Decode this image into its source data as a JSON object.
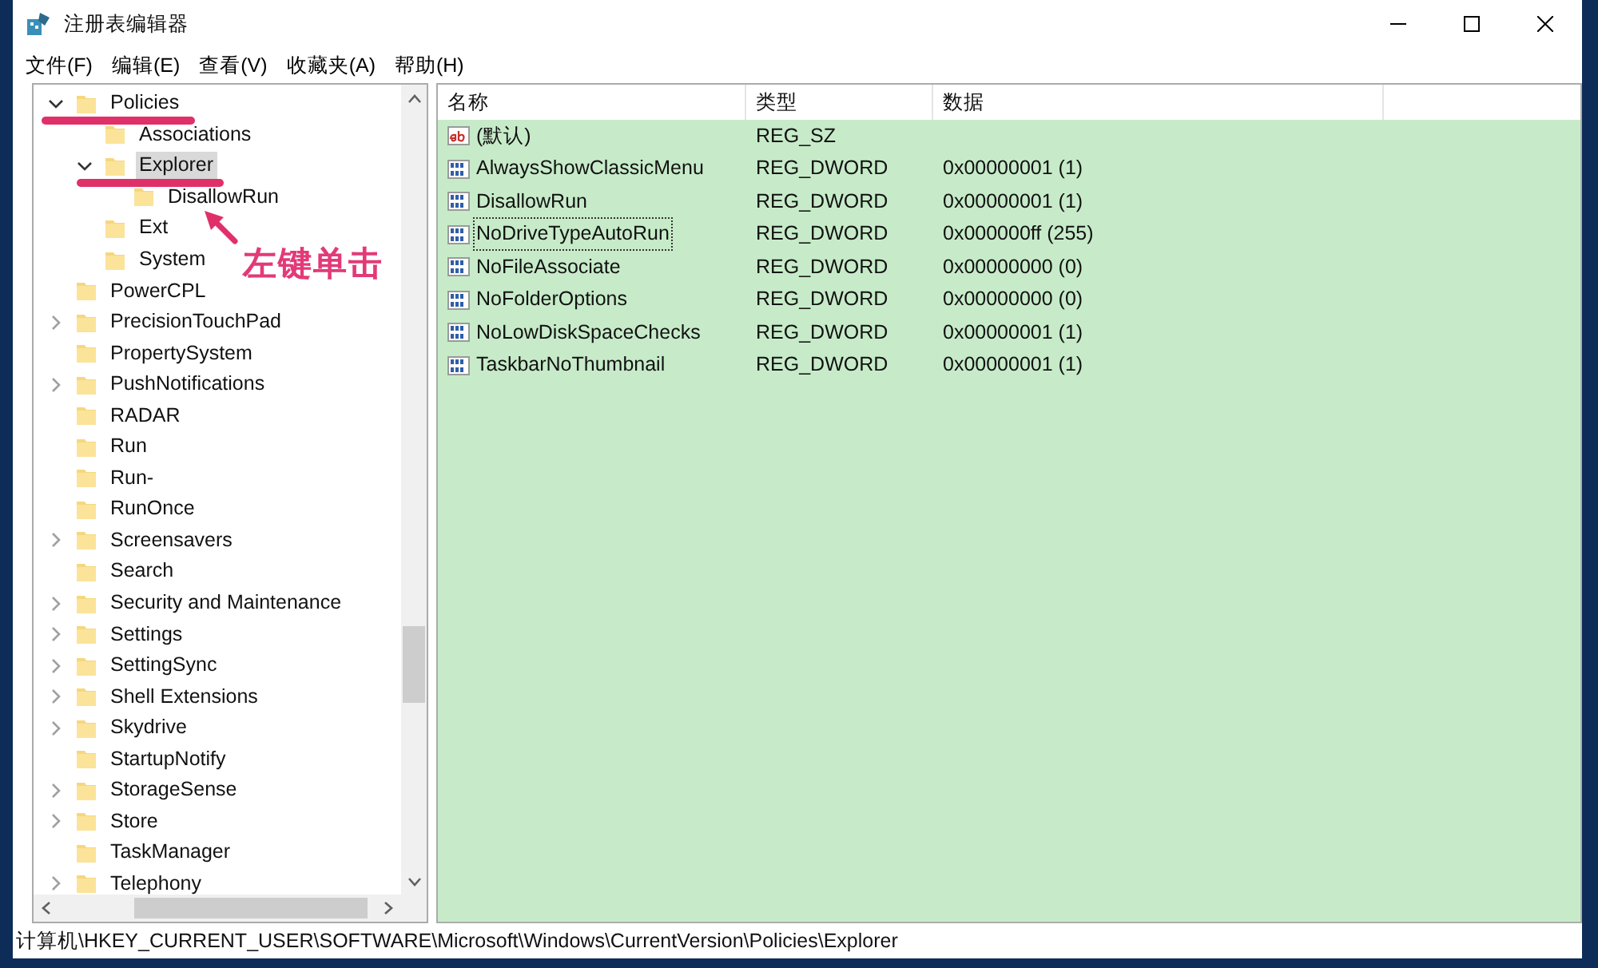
{
  "window": {
    "title": "注册表编辑器"
  },
  "menu": [
    "文件(F)",
    "编辑(E)",
    "查看(V)",
    "收藏夹(A)",
    "帮助(H)"
  ],
  "tree": [
    {
      "label": "Policies",
      "expanded": true,
      "selected": false,
      "children": [
        {
          "label": "Associations",
          "selected": false
        },
        {
          "label": "Explorer",
          "expanded": true,
          "selected": true,
          "children": [
            {
              "label": "DisallowRun",
              "selected": false
            }
          ]
        },
        {
          "label": "Ext",
          "selected": false
        },
        {
          "label": "System",
          "selected": false
        }
      ]
    },
    {
      "label": "PowerCPL",
      "selected": false
    },
    {
      "label": "PrecisionTouchPad",
      "expanded": false,
      "selected": false
    },
    {
      "label": "PropertySystem",
      "selected": false
    },
    {
      "label": "PushNotifications",
      "expanded": false,
      "selected": false
    },
    {
      "label": "RADAR",
      "selected": false
    },
    {
      "label": "Run",
      "selected": false
    },
    {
      "label": "Run-",
      "selected": false
    },
    {
      "label": "RunOnce",
      "selected": false
    },
    {
      "label": "Screensavers",
      "expanded": false,
      "selected": false
    },
    {
      "label": "Search",
      "selected": false
    },
    {
      "label": "Security and Maintenance",
      "expanded": false,
      "selected": false
    },
    {
      "label": "Settings",
      "expanded": false,
      "selected": false
    },
    {
      "label": "SettingSync",
      "expanded": false,
      "selected": false
    },
    {
      "label": "Shell Extensions",
      "expanded": false,
      "selected": false
    },
    {
      "label": "Skydrive",
      "expanded": false,
      "selected": false
    },
    {
      "label": "StartupNotify",
      "selected": false
    },
    {
      "label": "StorageSense",
      "expanded": false,
      "selected": false
    },
    {
      "label": "Store",
      "expanded": false,
      "selected": false
    },
    {
      "label": "TaskManager",
      "selected": false
    },
    {
      "label": "Telephony",
      "expanded": false,
      "selected": false
    }
  ],
  "values": {
    "columns": [
      "名称",
      "类型",
      "数据"
    ],
    "rows": [
      {
        "kind": "string",
        "name": "(默认)",
        "type": "REG_SZ",
        "focused": false
      },
      {
        "kind": "number",
        "name": "AlwaysShowClassicMenu",
        "type": "REG_DWORD",
        "data": "0x00000001 (1)",
        "focused": false
      },
      {
        "kind": "number",
        "name": "DisallowRun",
        "type": "REG_DWORD",
        "data": "0x00000001 (1)",
        "focused": false
      },
      {
        "kind": "number",
        "name": "NoDriveTypeAutoRun",
        "type": "REG_DWORD",
        "data": "0x000000ff (255)",
        "focused": true
      },
      {
        "kind": "number",
        "name": "NoFileAssociate",
        "type": "REG_DWORD",
        "data": "0x00000000 (0)",
        "focused": false
      },
      {
        "kind": "number",
        "name": "NoFolderOptions",
        "type": "REG_DWORD",
        "data": "0x00000000 (0)",
        "focused": false
      },
      {
        "kind": "number",
        "name": "NoLowDiskSpaceChecks",
        "type": "REG_DWORD",
        "data": "0x00000001 (1)",
        "focused": false
      },
      {
        "kind": "number",
        "name": "TaskbarNoThumbnail",
        "type": "REG_DWORD",
        "data": "0x00000001 (1)",
        "focused": false
      }
    ]
  },
  "status_bar": "计算机\\HKEY_CURRENT_USER\\SOFTWARE\\Microsoft\\Windows\\CurrentVersion\\Policies\\Explorer",
  "annotation": {
    "text": "左键单击"
  }
}
